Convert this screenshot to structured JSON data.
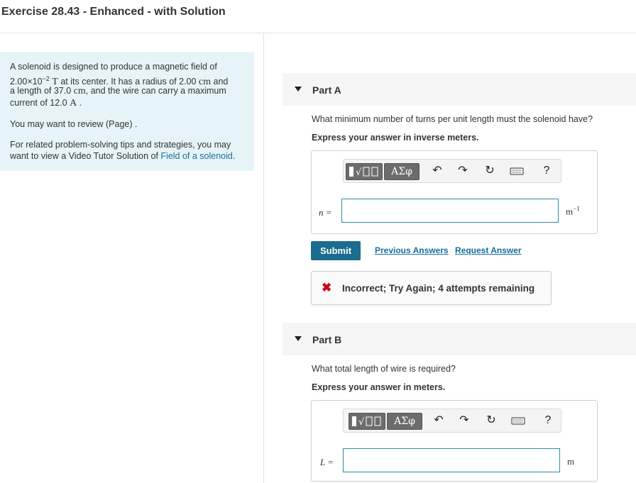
{
  "header": {
    "title": "Exercise 28.43 - Enhanced - with Solution"
  },
  "intro": {
    "p1_a": "A solenoid is designed to produce a magnetic field of",
    "p1_b_val": "2.00×10",
    "p1_b_exp": "−2",
    "p1_b_unit": "T",
    "p1_b_rest": " at its center. It has a radius of 2.00",
    "p1_b_unit2": "cm",
    "p1_b_end": "and",
    "p1_c": "a length of 37.0",
    "p1_c_unit": "cm",
    "p1_c_rest": ", and the wire can carry a maximum",
    "p1_d": "current of 12.0",
    "p1_d_unit": "A",
    "p1_d_end": ".",
    "p2": "You may want to review (Page) .",
    "p3_a": "For related problem-solving tips and strategies, you may",
    "p3_b": "want to view a Video Tutor Solution of ",
    "p3_link": "Field of a solenoid",
    "p3_end": "."
  },
  "partA": {
    "label": "Part A",
    "question": "What minimum number of turns per unit length must the solenoid have?",
    "instruction": "Express your answer in inverse meters.",
    "variable": "n =",
    "input_value": "",
    "unit_base": "m",
    "unit_exp": "−1",
    "submit_label": "Submit",
    "previous_answers": "Previous Answers",
    "request_answer": "Request Answer",
    "feedback_icon": "✖",
    "feedback": "Incorrect; Try Again; 4 attempts remaining"
  },
  "partB": {
    "label": "Part B",
    "question": "What total length of wire is required?",
    "instruction": "Express your answer in meters.",
    "variable": "L =",
    "input_value": "",
    "unit": "m"
  },
  "toolbar": {
    "greek": "ΑΣφ",
    "help": "?",
    "undo_icon": "↶",
    "redo_icon": "↷",
    "reset_icon": "↻"
  },
  "colors": {
    "accent": "#1a6d8e",
    "link": "#1a6d9e",
    "intro_bg": "#e6f4f8",
    "error": "#d0021b"
  }
}
